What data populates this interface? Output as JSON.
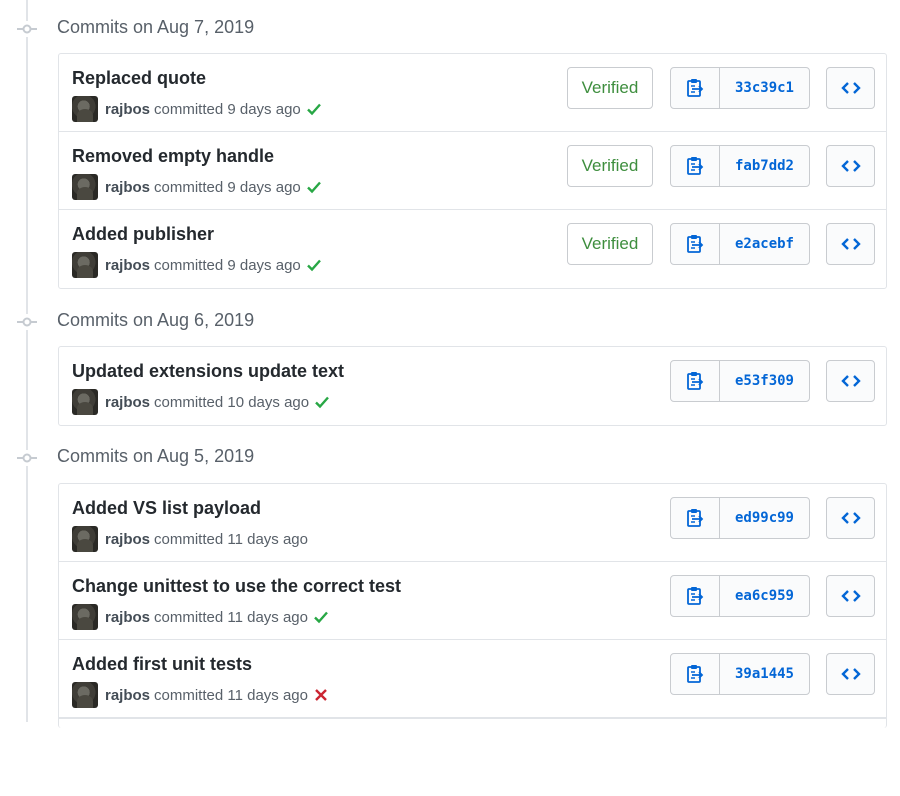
{
  "groups": [
    {
      "title": "Commits on Aug 7, 2019",
      "commits": [
        {
          "message": "Replaced quote",
          "author": "rajbos",
          "committed": "committed 9 days ago",
          "status": "success",
          "verified": "Verified",
          "sha": "33c39c1"
        },
        {
          "message": "Removed empty handle",
          "author": "rajbos",
          "committed": "committed 9 days ago",
          "status": "success",
          "verified": "Verified",
          "sha": "fab7dd2"
        },
        {
          "message": "Added publisher",
          "author": "rajbos",
          "committed": "committed 9 days ago",
          "status": "success",
          "verified": "Verified",
          "sha": "e2acebf"
        }
      ]
    },
    {
      "title": "Commits on Aug 6, 2019",
      "commits": [
        {
          "message": "Updated extensions update text",
          "author": "rajbos",
          "committed": "committed 10 days ago",
          "status": "success",
          "verified": "",
          "sha": "e53f309"
        }
      ]
    },
    {
      "title": "Commits on Aug 5, 2019",
      "commits": [
        {
          "message": "Added VS list payload",
          "author": "rajbos",
          "committed": "committed 11 days ago",
          "status": "none",
          "verified": "",
          "sha": "ed99c99"
        },
        {
          "message": "Change unittest to use the correct test",
          "author": "rajbos",
          "committed": "committed 11 days ago",
          "status": "success",
          "verified": "",
          "sha": "ea6c959"
        },
        {
          "message": "Added first unit tests",
          "author": "rajbos",
          "committed": "committed 11 days ago",
          "status": "failure",
          "verified": "",
          "sha": "39a1445"
        }
      ]
    }
  ],
  "colors": {
    "success": "#28a745",
    "failure": "#cb2431",
    "link": "#0366d6"
  },
  "icons": {
    "copy": "clippy-icon",
    "browse": "code-icon",
    "group": "git-commit-icon"
  }
}
